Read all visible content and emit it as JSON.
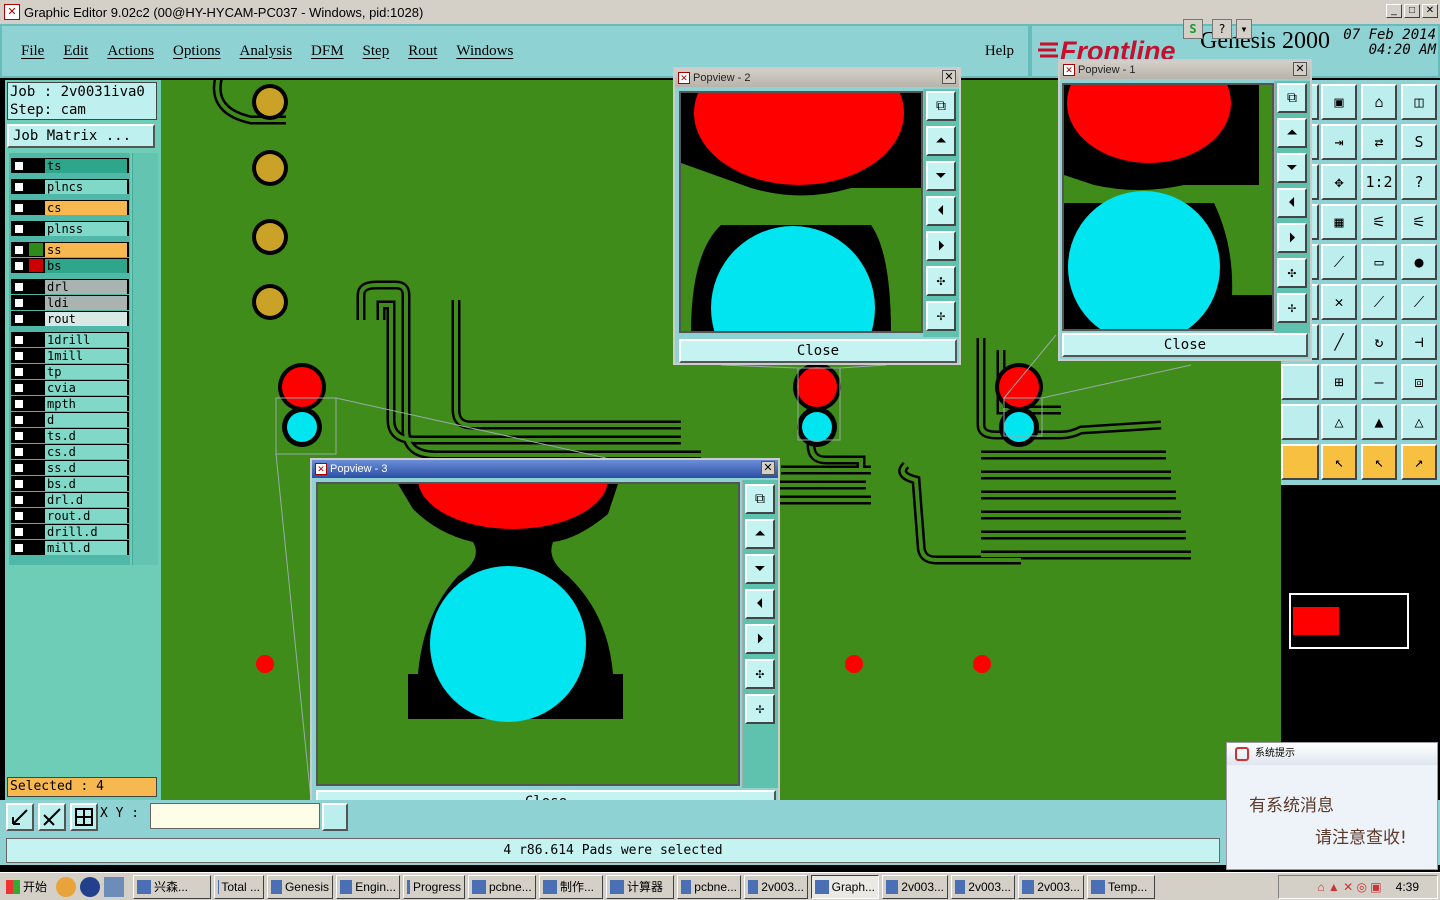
{
  "window": {
    "title": "Graphic Editor 9.02c2 (00@HY-HYCAM-PC037 - Windows, pid:1028)",
    "min": "_",
    "max": "□",
    "close": "✕"
  },
  "menu": [
    "File",
    "Edit",
    "Actions",
    "Options",
    "Analysis",
    "DFM",
    "Step",
    "Rout",
    "Windows"
  ],
  "help": "Help",
  "brand": {
    "frontline": "Frontline",
    "genesis": "Genesis 2000",
    "date": "07 Feb 2014",
    "time": "04:20 AM"
  },
  "job": {
    "job_line": "Job  : 2v0031iva0",
    "step_line": "Step: cam",
    "matrix_button": "Job Matrix ..."
  },
  "layers": [
    {
      "name": "ts",
      "color": "#2ea68c",
      "ind": "#000"
    },
    {
      "name": "plncs",
      "color": "#7fd8c8",
      "ind": "#000"
    },
    {
      "name": "cs",
      "color": "#f7b850",
      "ind": "#000"
    },
    {
      "name": "plnss",
      "color": "#7fd8c8",
      "ind": "#000"
    },
    {
      "name": "ss",
      "color": "#f7b850",
      "ind": "#2e8b1a"
    },
    {
      "name": "bs",
      "color": "#2ea68c",
      "ind": "#c00"
    },
    {
      "name": "drl",
      "color": "#a9b3b0",
      "ind": "#000"
    },
    {
      "name": "ldi",
      "color": "#a9b3b0",
      "ind": "#000"
    },
    {
      "name": "rout",
      "color": "#d9e9e6",
      "ind": "#000"
    },
    {
      "name": "1drill",
      "color": "#7fd8c8",
      "ind": "#000"
    },
    {
      "name": "1mill",
      "color": "#7fd8c8",
      "ind": "#000"
    },
    {
      "name": "tp",
      "color": "#7fd8c8",
      "ind": "#000"
    },
    {
      "name": "cvia",
      "color": "#7fd8c8",
      "ind": "#000"
    },
    {
      "name": "mpth",
      "color": "#7fd8c8",
      "ind": "#000"
    },
    {
      "name": "d",
      "color": "#7fd8c8",
      "ind": "#000"
    },
    {
      "name": "ts.d",
      "color": "#7fd8c8",
      "ind": "#000"
    },
    {
      "name": "cs.d",
      "color": "#7fd8c8",
      "ind": "#000"
    },
    {
      "name": "ss.d",
      "color": "#7fd8c8",
      "ind": "#000"
    },
    {
      "name": "bs.d",
      "color": "#7fd8c8",
      "ind": "#000"
    },
    {
      "name": "drl.d",
      "color": "#7fd8c8",
      "ind": "#000"
    },
    {
      "name": "rout.d",
      "color": "#7fd8c8",
      "ind": "#000"
    },
    {
      "name": "drill.d",
      "color": "#7fd8c8",
      "ind": "#000"
    },
    {
      "name": "mill.d",
      "color": "#7fd8c8",
      "ind": "#000"
    }
  ],
  "selected": "Selected : 4",
  "xy_label": "X Y :",
  "message": "4 r86.614 Pads were selected",
  "popviews": {
    "p1": "Popview - 1",
    "p2": "Popview - 2",
    "p3": "Popview - 3",
    "close": "Close"
  },
  "notification": {
    "title": "系统提示",
    "line1": "有系统消息",
    "line2": "请注意查收!"
  },
  "taskbar": {
    "start": "开始",
    "tasks": [
      "兴森...",
      "Total ...",
      "Genesis",
      "Engin...",
      "Progress",
      "pcbne...",
      "制作...",
      "计算器",
      "pcbne...",
      "2v003...",
      "Graph...",
      "2v003...",
      "2v003...",
      "2v003...",
      "Temp..."
    ],
    "clock": "4:39"
  },
  "colors": {
    "board": "#3f8c1b",
    "pad_red": "#ff0000",
    "pad_cyan": "#00e5f0",
    "panel": "#8fd2d4",
    "brand_red": "#c8102e"
  }
}
